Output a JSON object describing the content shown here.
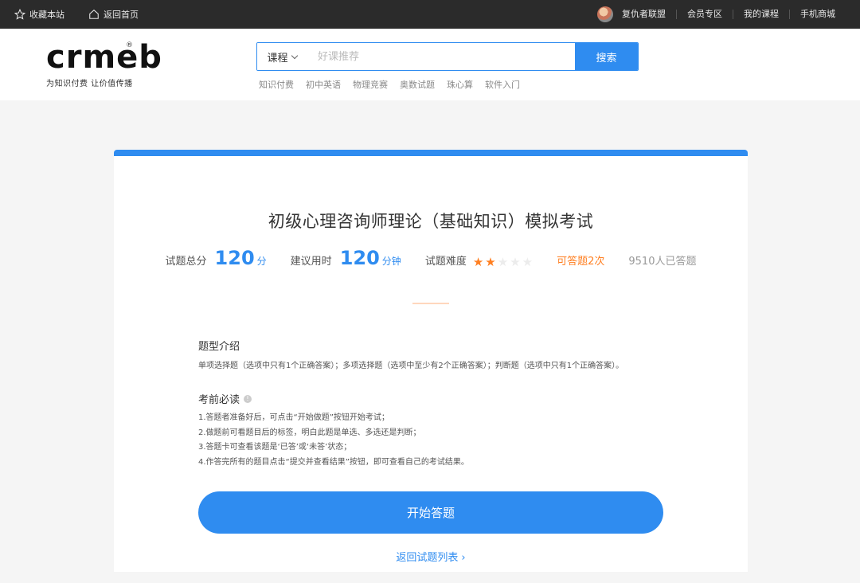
{
  "topbar": {
    "favorite": "收藏本站",
    "home": "返回首页",
    "username": "复仇者联盟",
    "links": [
      "会员专区",
      "我的课程",
      "手机商城"
    ]
  },
  "header": {
    "logo_text": "crmeb",
    "logo_reg": "®",
    "slogan": "为知识付费 让价值传播",
    "search": {
      "category": "课程",
      "placeholder": "好课推荐",
      "button": "搜索"
    },
    "hot_tags": [
      "知识付费",
      "初中英语",
      "物理竞赛",
      "奥数试题",
      "珠心算",
      "软件入门"
    ]
  },
  "exam": {
    "title": "初级心理咨询师理论（基础知识）模拟考试",
    "total_score_label": "试题总分",
    "total_score": "120",
    "total_score_unit": "分",
    "time_label": "建议用时",
    "time": "120",
    "time_unit": "分钟",
    "difficulty_label": "试题难度",
    "difficulty_stars": 2,
    "difficulty_max": 5,
    "attempts": "可答题2次",
    "answered_count": "9510人已答题"
  },
  "intro": {
    "title": "题型介绍",
    "text": "单项选择题（选项中只有1个正确答案）；多项选择题（选项中至少有2个正确答案）；判断题（选项中只有1个正确答案）。"
  },
  "notice": {
    "title": "考前必读",
    "rules": [
      "1.答题者准备好后，可点击“开始做题”按钮开始考试；",
      "2.做题前可看题目后的标签，明白此题是单选、多选还是判断；",
      "3.答题卡可查看该题是‘已答’或‘未答’状态；",
      "4.作答完所有的题目点击“提交并查看结果”按钮，即可查看自己的考试结果。"
    ]
  },
  "actions": {
    "start": "开始答题",
    "back": "返回试题列表",
    "back_arrow": "›"
  },
  "colors": {
    "accent": "#2f8cf0",
    "orange": "#ff7f21",
    "topbar": "#2b2b2b"
  }
}
